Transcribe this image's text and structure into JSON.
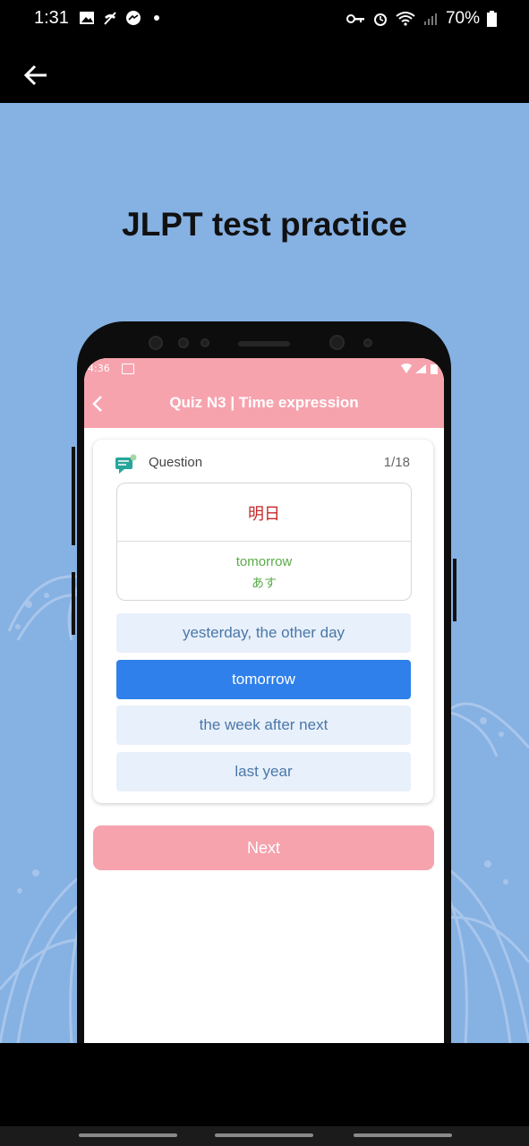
{
  "status_bar": {
    "time": "1:31",
    "left_icons": [
      "image-icon",
      "signal-off-icon",
      "messenger-icon",
      "dot-icon"
    ],
    "right_icons": [
      "key-icon",
      "alarm-icon",
      "wifi-icon",
      "cell-signal-icon"
    ],
    "battery": "70%"
  },
  "promo": {
    "title": "JLPT test practice",
    "background": "#86b1e3"
  },
  "inner_screen": {
    "status_time": "4:36",
    "header_title": "Quiz N3 | Time expression",
    "accent": "#f6a3ae"
  },
  "question": {
    "label": "Question",
    "counter": "1/18",
    "kanji": "明日",
    "meaning": "tomorrow",
    "reading": "あす"
  },
  "options": [
    {
      "label": "yesterday, the other day",
      "selected": false
    },
    {
      "label": "tomorrow",
      "selected": true
    },
    {
      "label": "the week after next",
      "selected": false
    },
    {
      "label": "last year",
      "selected": false
    }
  ],
  "next_label": "Next"
}
